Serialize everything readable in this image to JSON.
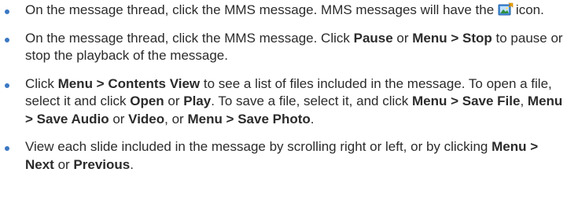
{
  "colors": {
    "bullet": "#3a78c2",
    "text": "#2b2b2b"
  },
  "icon": "mms-message-icon",
  "items": [
    {
      "segments": [
        {
          "t": "On the message thread, click the MMS message. MMS messages will have the",
          "b": false
        },
        {
          "icon": true
        },
        {
          "t": "icon.",
          "b": false
        }
      ]
    },
    {
      "segments": [
        {
          "t": "On the message thread, click the MMS message. Click ",
          "b": false
        },
        {
          "t": "Pause",
          "b": true
        },
        {
          "t": " or ",
          "b": false
        },
        {
          "t": "Menu > Stop",
          "b": true
        },
        {
          "t": " to pause or stop the playback of the message.",
          "b": false
        }
      ]
    },
    {
      "segments": [
        {
          "t": "Click ",
          "b": false
        },
        {
          "t": "Menu > Contents View",
          "b": true
        },
        {
          "t": " to see a list of files included in the message. To open a file, select it and click ",
          "b": false
        },
        {
          "t": "Open",
          "b": true
        },
        {
          "t": " or ",
          "b": false
        },
        {
          "t": "Play",
          "b": true
        },
        {
          "t": ". To save a file, select it, and click ",
          "b": false
        },
        {
          "t": "Menu > Save File",
          "b": true
        },
        {
          "t": ", ",
          "b": false
        },
        {
          "t": "Menu > Save Audio",
          "b": true
        },
        {
          "t": " or ",
          "b": false
        },
        {
          "t": "Video",
          "b": true
        },
        {
          "t": ", or ",
          "b": false
        },
        {
          "t": "Menu > Save Photo",
          "b": true
        },
        {
          "t": ".",
          "b": false
        }
      ]
    },
    {
      "segments": [
        {
          "t": "View each slide included in the message by scrolling right or left, or by clicking ",
          "b": false
        },
        {
          "t": "Menu > Next",
          "b": true
        },
        {
          "t": " or ",
          "b": false
        },
        {
          "t": "Previous",
          "b": true
        },
        {
          "t": ".",
          "b": false
        }
      ]
    }
  ]
}
